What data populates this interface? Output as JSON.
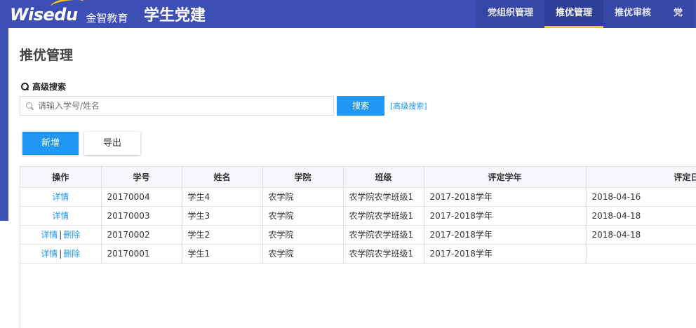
{
  "header": {
    "logo_text": "Wisedu",
    "logo_cn": "金智教育",
    "app_title": "学生党建",
    "nav": [
      {
        "label": "党组织管理",
        "active": false
      },
      {
        "label": "推优管理",
        "active": true
      },
      {
        "label": "推优审核",
        "active": false
      },
      {
        "label": "党",
        "active": false
      }
    ]
  },
  "colors": {
    "primary": "#2196f3",
    "header": "#3d4fb4",
    "accent": "#f5c518"
  },
  "page": {
    "title": "推优管理"
  },
  "search": {
    "label": "高级搜索",
    "placeholder": "请输入学号/姓名",
    "button": "搜索",
    "advanced_link": "[高级搜索]"
  },
  "toolbar": {
    "add_label": "新增",
    "export_label": "导出"
  },
  "table": {
    "columns": [
      "操作",
      "学号",
      "姓名",
      "学院",
      "班级",
      "评定学年",
      "评定日期"
    ],
    "rows": [
      {
        "ops": [
          "详情"
        ],
        "id": "20170004",
        "name": "学生4",
        "college": "农学院",
        "class": "农学院农学班级1",
        "year": "2017-2018学年",
        "date": "2018-04-16"
      },
      {
        "ops": [
          "详情"
        ],
        "id": "20170003",
        "name": "学生3",
        "college": "农学院",
        "class": "农学院农学班级1",
        "year": "2017-2018学年",
        "date": "2018-04-18"
      },
      {
        "ops": [
          "详情",
          "删除"
        ],
        "id": "20170002",
        "name": "学生2",
        "college": "农学院",
        "class": "农学院农学班级1",
        "year": "2017-2018学年",
        "date": "2018-04-18"
      },
      {
        "ops": [
          "详情",
          "删除"
        ],
        "id": "20170001",
        "name": "学生1",
        "college": "农学院",
        "class": "农学院农学班级1",
        "year": "2017-2018学年",
        "date": ""
      }
    ]
  }
}
